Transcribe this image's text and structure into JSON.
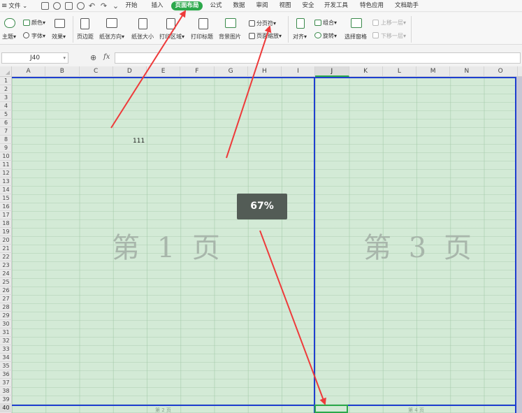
{
  "menu": {
    "hamburger": "≡",
    "file": "文件",
    "file_caret": "⌄",
    "tabs": [
      {
        "label": "开始"
      },
      {
        "label": "插入"
      },
      {
        "label": "页面布局",
        "active": true
      },
      {
        "label": "公式"
      },
      {
        "label": "数据"
      },
      {
        "label": "审阅"
      },
      {
        "label": "视图"
      },
      {
        "label": "安全"
      },
      {
        "label": "开发工具"
      },
      {
        "label": "特色应用"
      },
      {
        "label": "文档助手"
      }
    ],
    "undo": "↶",
    "redo": "↷",
    "more": "⌄"
  },
  "ribbon": {
    "theme": "主题",
    "colors": "颜色",
    "fonts": "字体",
    "effects": "效果",
    "margins": "页边距",
    "orientation": "纸张方向",
    "size": "纸张大小",
    "print_area": "打印区域",
    "print_titles": "打印标题",
    "background": "背景图片",
    "page_break": "分页符",
    "page_zoom": "页面缩放",
    "align": "对齐",
    "group": "组合",
    "rotate": "旋转",
    "selection_pane": "选择窗格",
    "bring_forward": "上移一层",
    "send_backward": "下移一层",
    "caret": "▾"
  },
  "formula_bar": {
    "cell_ref": "J40",
    "name_caret": "▾",
    "zoom_glyph": "⊕",
    "fx": "fx",
    "formula": ""
  },
  "sheet": {
    "columns": [
      "A",
      "B",
      "C",
      "D",
      "E",
      "F",
      "G",
      "H",
      "I",
      "J",
      "K",
      "L",
      "M",
      "N",
      "O"
    ],
    "selected_column": "J",
    "rows": [
      "1",
      "2",
      "3",
      "4",
      "5",
      "6",
      "7",
      "8",
      "9",
      "10",
      "11",
      "12",
      "13",
      "14",
      "15",
      "16",
      "17",
      "18",
      "19",
      "20",
      "21",
      "22",
      "23",
      "24",
      "25",
      "26",
      "27",
      "28",
      "29",
      "30",
      "31",
      "32",
      "33",
      "34",
      "35",
      "36",
      "37",
      "38",
      "39",
      "40"
    ],
    "selected_row": "40",
    "cell_d8_value": "111",
    "page_watermarks": [
      "第 1 页",
      "第 3 页"
    ],
    "page_footers": [
      "第 2 页",
      "第 4 页"
    ]
  },
  "zoom_toast": "67%",
  "colors": {
    "accent_green": "#2ca84b",
    "page_break_blue": "#1f3fd0",
    "annotation_red": "#ee3a3a",
    "sheet_background": "#d3ead6"
  }
}
